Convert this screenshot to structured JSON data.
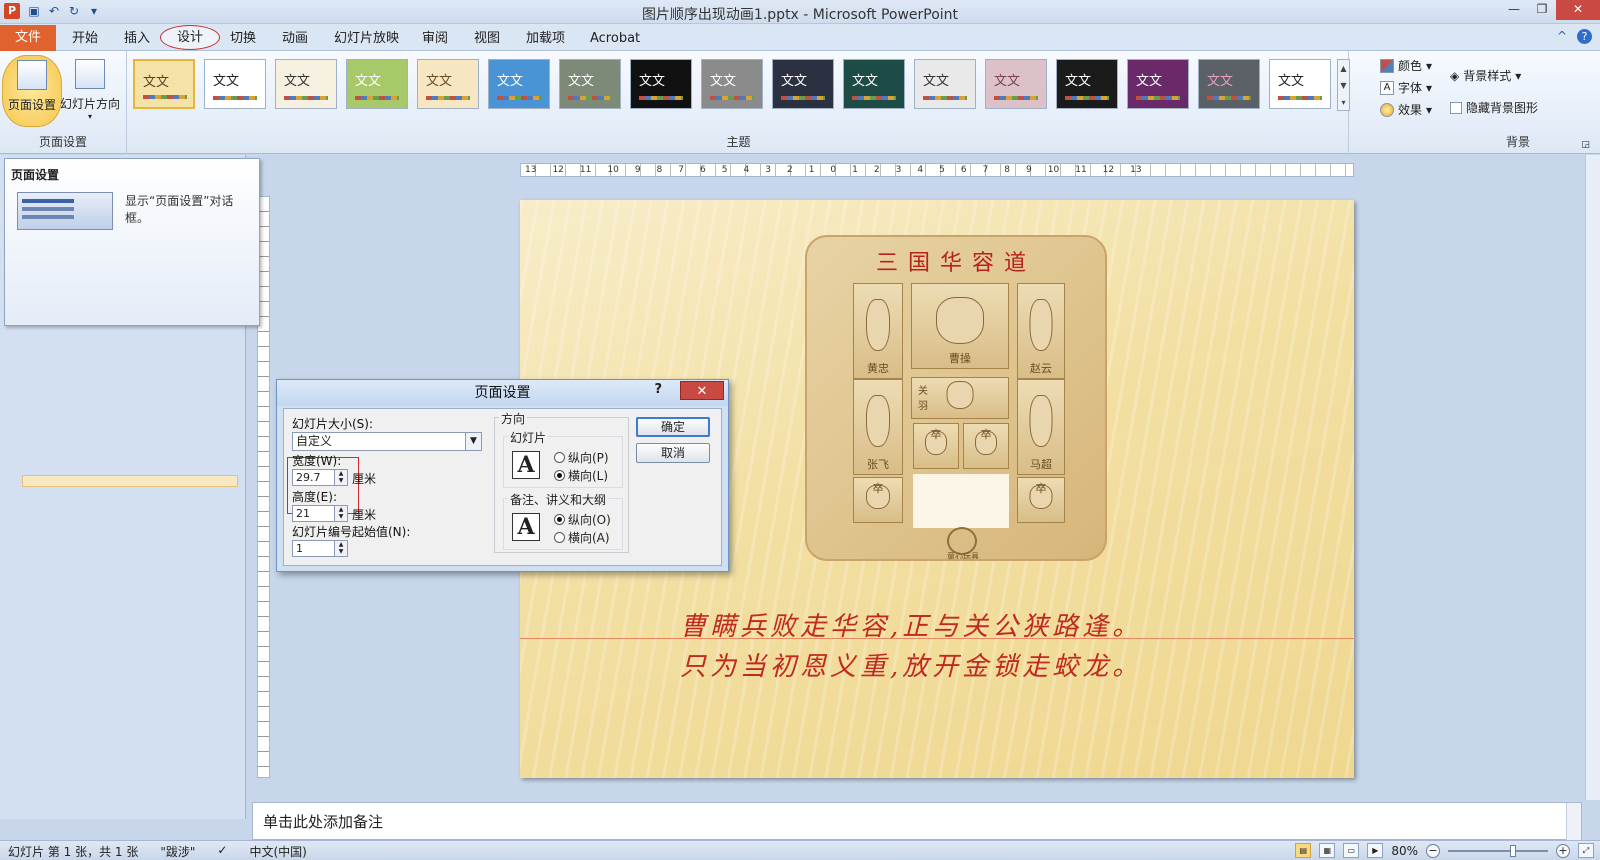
{
  "window": {
    "title": "图片顺序出现动画1.pptx - Microsoft PowerPoint",
    "app_icon": "P",
    "close_label": "✕",
    "restore_label": "❐",
    "minimize_label": "—"
  },
  "tabs": [
    "文件",
    "开始",
    "插入",
    "设计",
    "切换",
    "动画",
    "幻灯片放映",
    "审阅",
    "视图",
    "加载项",
    "Acrobat"
  ],
  "tab_right": {
    "collapse": "^",
    "help": "?"
  },
  "ribbon": {
    "page_group": {
      "page_setup_label": "页面设置",
      "orientation_label": "幻灯片方向",
      "group_label": "页面设置"
    },
    "themes_group": {
      "theme_sample": "文文",
      "group_label": "主题",
      "themes": [
        {
          "bg": "#f4e2a8",
          "fg": "#5a4120"
        },
        {
          "bg": "#ffffff",
          "fg": "#222222"
        },
        {
          "bg": "#f5f0e0",
          "fg": "#333333"
        },
        {
          "bg": "#a7c96a",
          "fg": "#ffffff"
        },
        {
          "bg": "#f6e7c2",
          "fg": "#6b4a22"
        },
        {
          "bg": "#4a94d6",
          "fg": "#ffffff"
        },
        {
          "bg": "#7d8a78",
          "fg": "#ffffff"
        },
        {
          "bg": "#111111",
          "fg": "#ffffff"
        },
        {
          "bg": "#8b8b8b",
          "fg": "#ffffff"
        },
        {
          "bg": "#2c3142",
          "fg": "#ffffff"
        },
        {
          "bg": "#1d4b45",
          "fg": "#ffffff"
        },
        {
          "bg": "#e9e9e9",
          "fg": "#333333"
        },
        {
          "bg": "#dcc2c8",
          "fg": "#7a4050"
        },
        {
          "bg": "#1b1b1b",
          "fg": "#ffffff"
        },
        {
          "bg": "#6a2a6a",
          "fg": "#ffffff"
        },
        {
          "bg": "#5b5f66",
          "fg": "#e7a0c5"
        },
        {
          "bg": "#ffffff",
          "fg": "#222222"
        }
      ],
      "colors_label": "颜色",
      "fonts_label": "字体",
      "effects_label": "效果"
    },
    "background_group": {
      "bg_styles_label": "背景样式",
      "hide_graphics_label": "隐藏背景图形",
      "group_label": "背景"
    }
  },
  "tooltip": {
    "title": "页面设置",
    "description": "显示“页面设置”对话框。"
  },
  "ruler": {
    "labels": [
      "13",
      "12",
      "11",
      "10",
      "9",
      "8",
      "7",
      "6",
      "5",
      "4",
      "3",
      "2",
      "1",
      "0",
      "1",
      "2",
      "3",
      "4",
      "5",
      "6",
      "7",
      "8",
      "9",
      "10",
      "11",
      "12",
      "13"
    ]
  },
  "slide": {
    "puzzle_title": "三国华容道",
    "tiles": {
      "huangzhong": "黄忠",
      "caocao": "曹操",
      "zhaoyun": "赵云",
      "guanyu": "关羽",
      "zhangfei": "张飞",
      "machao": "马超",
      "soldier": "卒"
    },
    "logo_text": "童心玩具",
    "poem_line1": "曹瞒兵败走华容,正与关公狭路逢。",
    "poem_line2": "只为当初恩义重,放开金锁走蛟龙。"
  },
  "notes": {
    "placeholder": "单击此处添加备注"
  },
  "status": {
    "slide_info": "幻灯片 第 1 张，共 1 张",
    "theme_name": "\"跋涉\"",
    "language": "中文(中国)",
    "zoom": "80%",
    "zoom_fraction": 0.8
  },
  "dialog": {
    "title": "页面设置",
    "help": "?",
    "close": "✕",
    "slide_size_label": "幻灯片大小(S):",
    "slide_size_value": "自定义",
    "width_label": "宽度(W):",
    "width_value": "29.7",
    "height_label": "高度(E):",
    "height_value": "21",
    "unit": "厘米",
    "start_number_label": "幻灯片编号起始值(N):",
    "start_number_value": "1",
    "orientation_label": "方向",
    "slides_label": "幻灯片",
    "portrait_label": "纵向(P)",
    "landscape_label": "横向(L)",
    "notes_label": "备注、讲义和大纲",
    "notes_portrait_label": "纵向(O)",
    "notes_landscape_label": "横向(A)",
    "ok_label": "确定",
    "cancel_label": "取消"
  }
}
